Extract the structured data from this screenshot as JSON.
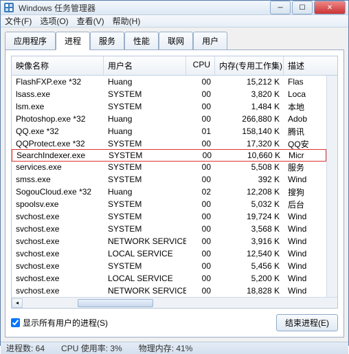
{
  "title": "Windows 任务管理器",
  "menus": [
    "文件(F)",
    "选项(O)",
    "查看(V)",
    "帮助(H)"
  ],
  "tabs": [
    "应用程序",
    "进程",
    "服务",
    "性能",
    "联网",
    "用户"
  ],
  "active_tab_index": 1,
  "columns": {
    "image_name": "映像名称",
    "user": "用户名",
    "cpu": "CPU",
    "memory": "内存(专用工作集)",
    "desc": "描述"
  },
  "processes": [
    {
      "name": "FlashFXP.exe *32",
      "user": "Huang",
      "cpu": "00",
      "mem": "15,212 K",
      "desc": "Flas",
      "hl": false
    },
    {
      "name": "lsass.exe",
      "user": "SYSTEM",
      "cpu": "00",
      "mem": "3,820 K",
      "desc": "Loca",
      "hl": false
    },
    {
      "name": "lsm.exe",
      "user": "SYSTEM",
      "cpu": "00",
      "mem": "1,484 K",
      "desc": "本地",
      "hl": false
    },
    {
      "name": "Photoshop.exe *32",
      "user": "Huang",
      "cpu": "00",
      "mem": "266,880 K",
      "desc": "Adob",
      "hl": false
    },
    {
      "name": "QQ.exe *32",
      "user": "Huang",
      "cpu": "01",
      "mem": "158,140 K",
      "desc": "腾讯",
      "hl": false
    },
    {
      "name": "QQProtect.exe *32",
      "user": "SYSTEM",
      "cpu": "00",
      "mem": "17,320 K",
      "desc": "QQ安",
      "hl": false
    },
    {
      "name": "SearchIndexer.exe",
      "user": "SYSTEM",
      "cpu": "00",
      "mem": "10,660 K",
      "desc": "Micr",
      "hl": true
    },
    {
      "name": "services.exe",
      "user": "SYSTEM",
      "cpu": "00",
      "mem": "5,508 K",
      "desc": "服务",
      "hl": false
    },
    {
      "name": "smss.exe",
      "user": "SYSTEM",
      "cpu": "00",
      "mem": "392 K",
      "desc": "Wind",
      "hl": false
    },
    {
      "name": "SogouCloud.exe *32",
      "user": "Huang",
      "cpu": "02",
      "mem": "12,208 K",
      "desc": "搜狗",
      "hl": false
    },
    {
      "name": "spoolsv.exe",
      "user": "SYSTEM",
      "cpu": "00",
      "mem": "5,032 K",
      "desc": "后台",
      "hl": false
    },
    {
      "name": "svchost.exe",
      "user": "SYSTEM",
      "cpu": "00",
      "mem": "19,724 K",
      "desc": "Wind",
      "hl": false
    },
    {
      "name": "svchost.exe",
      "user": "SYSTEM",
      "cpu": "00",
      "mem": "3,568 K",
      "desc": "Wind",
      "hl": false
    },
    {
      "name": "svchost.exe",
      "user": "NETWORK SERVICE",
      "cpu": "00",
      "mem": "3,916 K",
      "desc": "Wind",
      "hl": false
    },
    {
      "name": "svchost.exe",
      "user": "LOCAL SERVICE",
      "cpu": "00",
      "mem": "12,540 K",
      "desc": "Wind",
      "hl": false
    },
    {
      "name": "svchost.exe",
      "user": "SYSTEM",
      "cpu": "00",
      "mem": "5,456 K",
      "desc": "Wind",
      "hl": false
    },
    {
      "name": "svchost.exe",
      "user": "LOCAL SERVICE",
      "cpu": "00",
      "mem": "5,200 K",
      "desc": "Wind",
      "hl": false
    },
    {
      "name": "svchost.exe",
      "user": "NETWORK SERVICE",
      "cpu": "00",
      "mem": "18,828 K",
      "desc": "Wind",
      "hl": false
    }
  ],
  "checkbox_label": "显示所有用户的进程(S)",
  "checkbox_checked": true,
  "end_process_btn": "结束进程(E)",
  "status": {
    "proc_count": "进程数: 64",
    "cpu_usage": "CPU 使用率: 3%",
    "phys_mem": "物理内存: 41%"
  }
}
